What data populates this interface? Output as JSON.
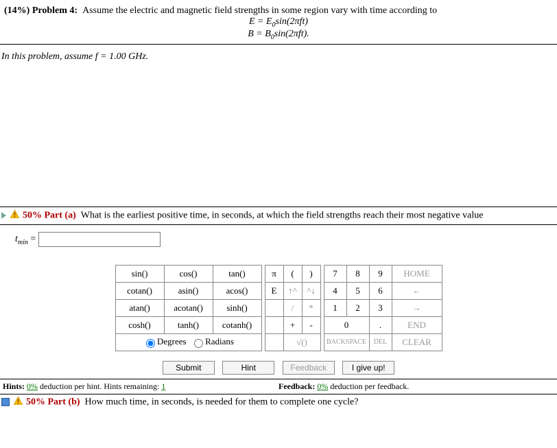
{
  "problem": {
    "weight": "(14%)",
    "label": "Problem 4:",
    "statement": "Assume the electric and magnetic field strengths in some region vary with time according to",
    "eq1_lhs": "E = E",
    "eq1_sub": "0",
    "eq1_rhs": "sin(2πft)",
    "eq2_lhs": "B = B",
    "eq2_sub": "0",
    "eq2_rhs": "sin(2πft).",
    "assume": "In this problem, assume f = 1.00 GHz."
  },
  "part_a": {
    "pct": "50%",
    "label": "Part (a)",
    "question": "What is the earliest positive time, in seconds, at which the field strengths reach their most negative value",
    "var": "t",
    "var_sub": "min",
    "equals": " = "
  },
  "calc": {
    "fns": [
      [
        "sin()",
        "cos()",
        "tan()"
      ],
      [
        "cotan()",
        "asin()",
        "acos()"
      ],
      [
        "atan()",
        "acotan()",
        "sinh()"
      ],
      [
        "cosh()",
        "tanh()",
        "cotanh()"
      ]
    ],
    "deg": "Degrees",
    "rad": "Radians",
    "mid": {
      "pi": "π",
      "lp": "(",
      "rp": ")",
      "E": "E",
      "up": "↑^",
      "dn": "^↓",
      "slash": "/",
      "star": "*",
      "plus": "+",
      "minus": "-",
      "sqrt": "√()"
    },
    "nums": {
      "7": "7",
      "8": "8",
      "9": "9",
      "4": "4",
      "5": "5",
      "6": "6",
      "1": "1",
      "2": "2",
      "3": "3",
      "0": "0",
      "dot": "."
    },
    "cmds": {
      "home": "HOME",
      "left": "←",
      "right": "→",
      "end": "END",
      "clear": "CLEAR",
      "bksp": "BACKSPACE",
      "del": "DEL"
    }
  },
  "buttons": {
    "submit": "Submit",
    "hint": "Hint",
    "feedback": "Feedback",
    "giveup": "I give up!"
  },
  "hints": {
    "label": "Hints:",
    "pct": "0%",
    "text": " deduction per hint. Hints remaining: ",
    "remain": "1",
    "flabel": "Feedback:",
    "fpct": "0%",
    "ftext": " deduction per feedback."
  },
  "part_b": {
    "pct": "50%",
    "label": "Part (b)",
    "question": "How much time, in seconds, is needed for them to complete one cycle?"
  }
}
